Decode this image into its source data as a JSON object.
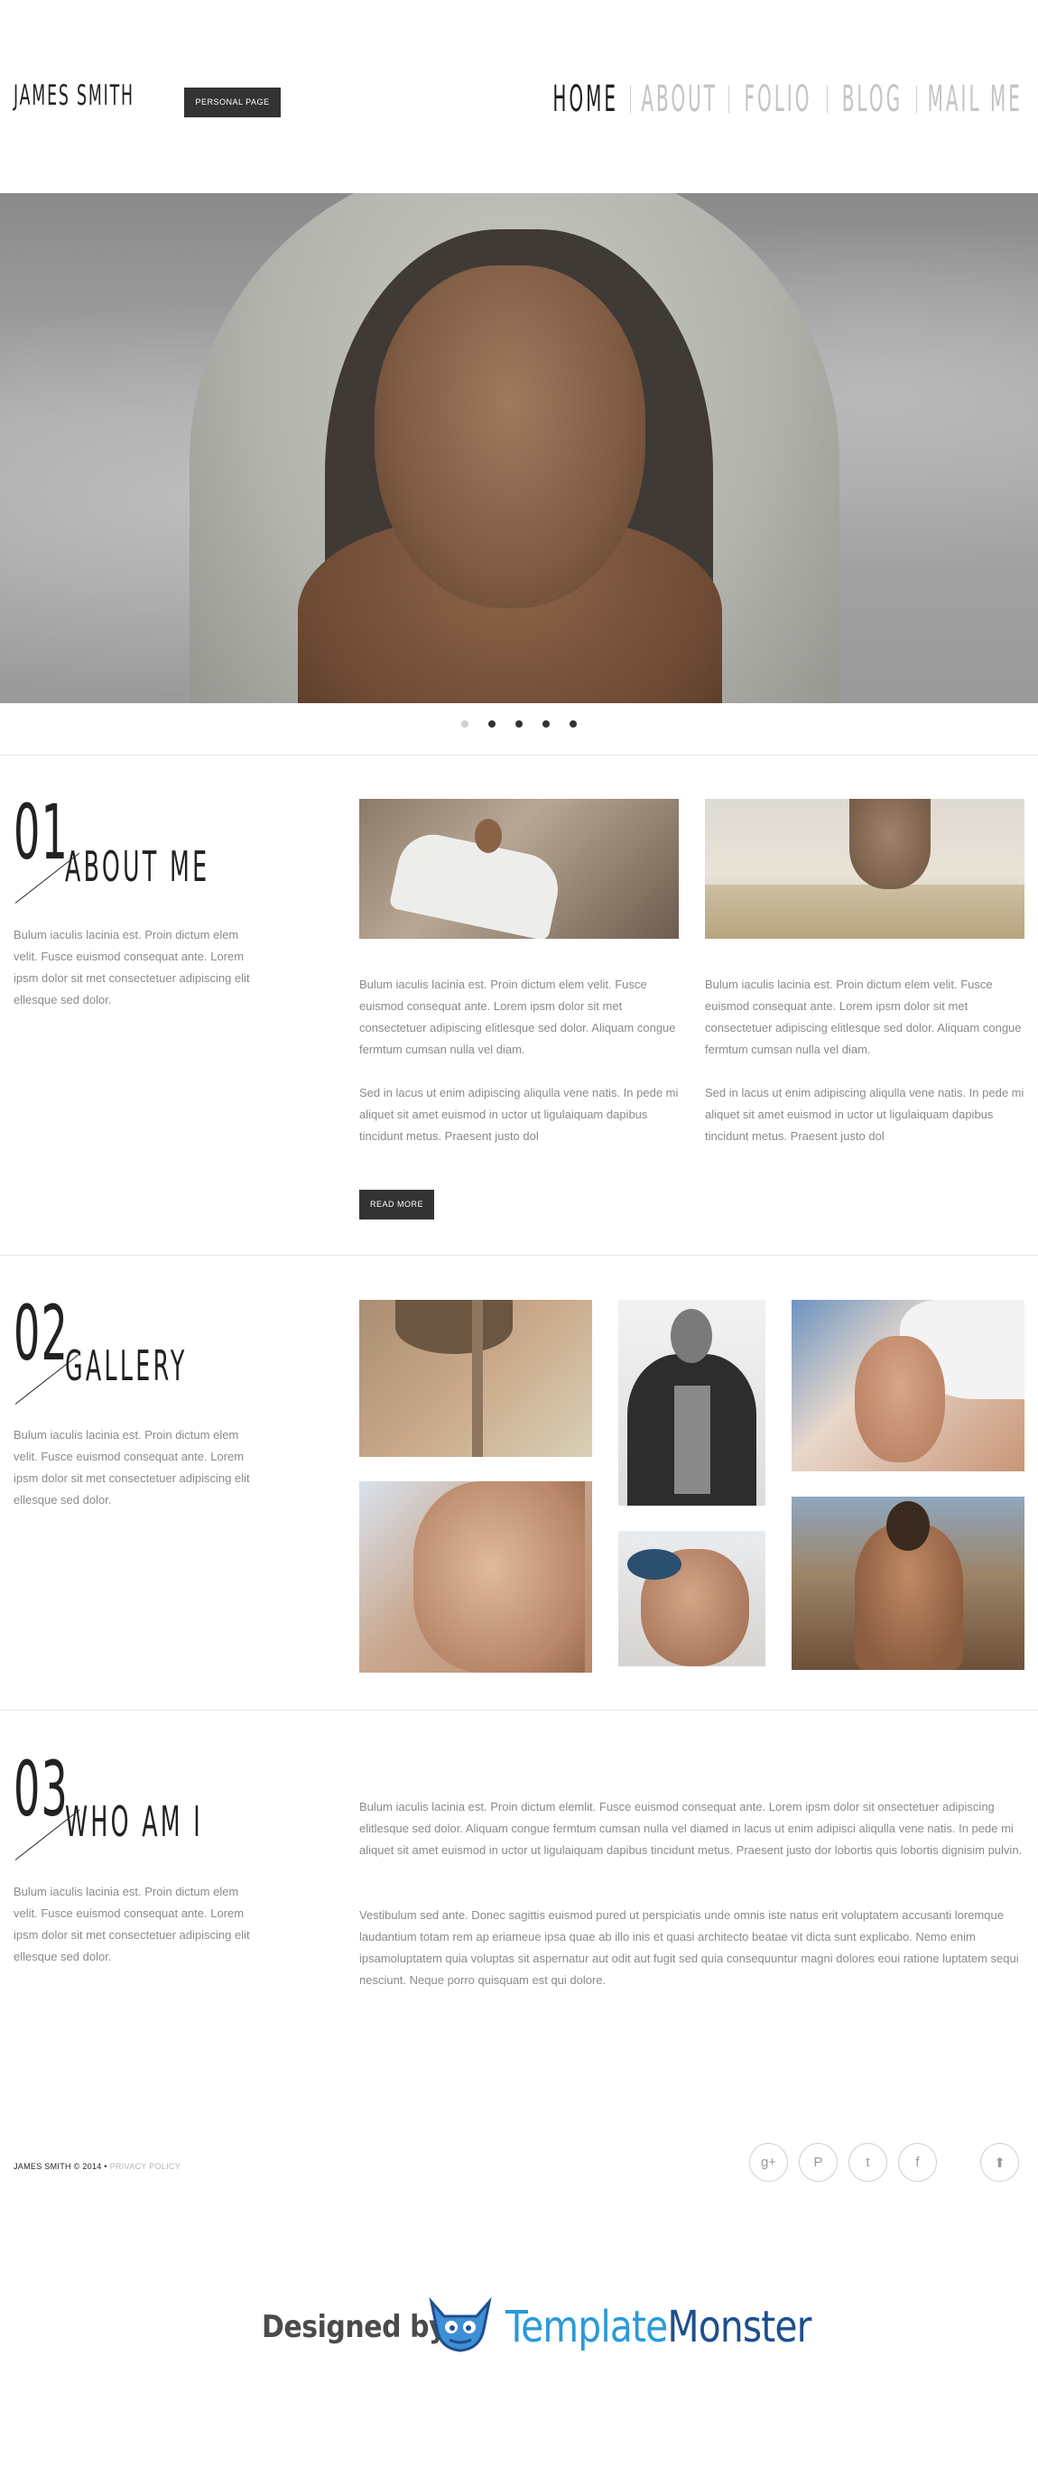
{
  "header": {
    "brand": "JAMES SMITH",
    "badge": "PERSONAL PAGE",
    "nav": [
      {
        "label": "HOME",
        "active": true
      },
      {
        "label": "ABOUT",
        "active": false
      },
      {
        "label": "FOLIO",
        "active": false
      },
      {
        "label": "BLOG",
        "active": false
      },
      {
        "label": "MAIL ME",
        "active": false
      }
    ]
  },
  "slider": {
    "dots": 5,
    "active_dot": 0
  },
  "about": {
    "number": "01",
    "title": "ABOUT ME",
    "side_text": "Bulum iaculis lacinia est. Proin dictum elem velit. Fusce euismod consequat ante. Lorem ipsm dolor sit met consectetuer adipiscing elit ellesque sed dolor.",
    "col1_p1": "Bulum iaculis lacinia est. Proin dictum elem velit. Fusce euismod consequat ante. Lorem ipsm dolor sit met consectetuer adipiscing elitlesque sed dolor. Aliquam congue fermtum cumsan nulla vel diam.",
    "col1_p2": "Sed in lacus ut enim adipiscing aliqulla vene natis. In pede mi aliquet sit amet euismod in uctor ut ligulaiquam dapibus tincidunt metus. Praesent justo dol",
    "col2_p1": "Bulum iaculis lacinia est. Proin dictum elem velit. Fusce euismod consequat ante. Lorem ipsm dolor sit met consectetuer adipiscing elitlesque sed dolor. Aliquam congue fermtum cumsan nulla vel diam.",
    "col2_p2": "Sed in lacus ut enim adipiscing aliqulla vene natis. In pede mi aliquet sit amet euismod in uctor ut ligulaiquam dapibus tincidunt metus. Praesent justo dol",
    "read_more": "READ MORE"
  },
  "gallery": {
    "number": "02",
    "title": "GALLERY",
    "side_text": "Bulum iaculis lacinia est. Proin dictum elem velit. Fusce euismod consequat ante. Lorem ipsm dolor sit met consectetuer adipiscing elit ellesque sed dolor."
  },
  "who": {
    "number": "03",
    "title": "WHO AM I",
    "side_text": "Bulum iaculis lacinia est. Proin dictum elem velit. Fusce euismod consequat ante. Lorem ipsm dolor sit met consectetuer adipiscing elit ellesque sed dolor.",
    "p1": "Bulum iaculis lacinia est. Proin dictum elemlit. Fusce euismod consequat ante. Lorem ipsm dolor sit onsectetuer adipiscing elitlesque sed dolor. Aliquam congue fermtum cumsan nulla vel diamed in lacus ut enim adipisci aliqulla vene natis. In pede mi aliquet sit amet euismod in uctor ut ligulaiquam dapibus tincidunt metus. Praesent justo dor lobortis quis lobortis dignisim pulvin.",
    "p2": "Vestibulum sed ante. Donec sagittis euismod pured ut perspiciatis unde omnis iste natus erit voluptatem accusanti loremque laudantium totam rem ap eriameue ipsa quae ab illo inis et quasi architecto beatae vit dicta sunt explicabo. Nemo enim ipsamoluptatem quia voluptas sit aspernatur aut odit aut fugit sed quia consequuntur magni dolores eoui ratione luptatem sequi nesciunt. Neque porro quisquam est qui dolore."
  },
  "footer": {
    "copyright": "JAMES SMITH © 2014 •",
    "privacy": "PRIVACY POLICY",
    "social": [
      {
        "icon": "google-plus-icon",
        "glyph": "g+"
      },
      {
        "icon": "pinterest-icon",
        "glyph": "P"
      },
      {
        "icon": "twitter-icon",
        "glyph": "t"
      },
      {
        "icon": "facebook-icon",
        "glyph": "f"
      }
    ],
    "scroll_top_glyph": "⬆"
  },
  "credit": {
    "designed_by": "Designed by",
    "brand_part1": "Template",
    "brand_part2": "Monster"
  },
  "colors": {
    "accent_dark": "#333333",
    "text_gray": "#8a8a8a",
    "tm_light_blue": "#2a9ad8",
    "tm_dark_blue": "#1d4f8f"
  }
}
